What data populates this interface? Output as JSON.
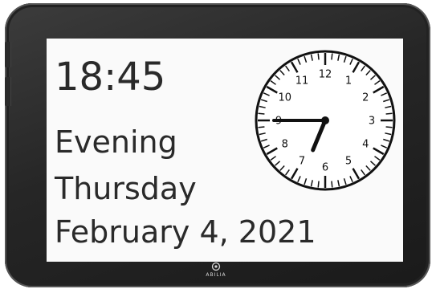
{
  "clock_display": {
    "time": "18:45",
    "day_period": "Evening",
    "weekday": "Thursday",
    "date": "February 4, 2021",
    "analog": {
      "hour": 18,
      "minute": 45,
      "numerals": [
        "12",
        "1",
        "2",
        "3",
        "4",
        "5",
        "6",
        "7",
        "8",
        "9",
        "10",
        "11"
      ]
    }
  },
  "device": {
    "brand": "ABILIA",
    "logo_icon": "abilia-logo-icon"
  },
  "colors": {
    "bezel": "#262626",
    "screen": "#fafafa",
    "text": "#2a2a2a",
    "clock_face": "#111111"
  }
}
